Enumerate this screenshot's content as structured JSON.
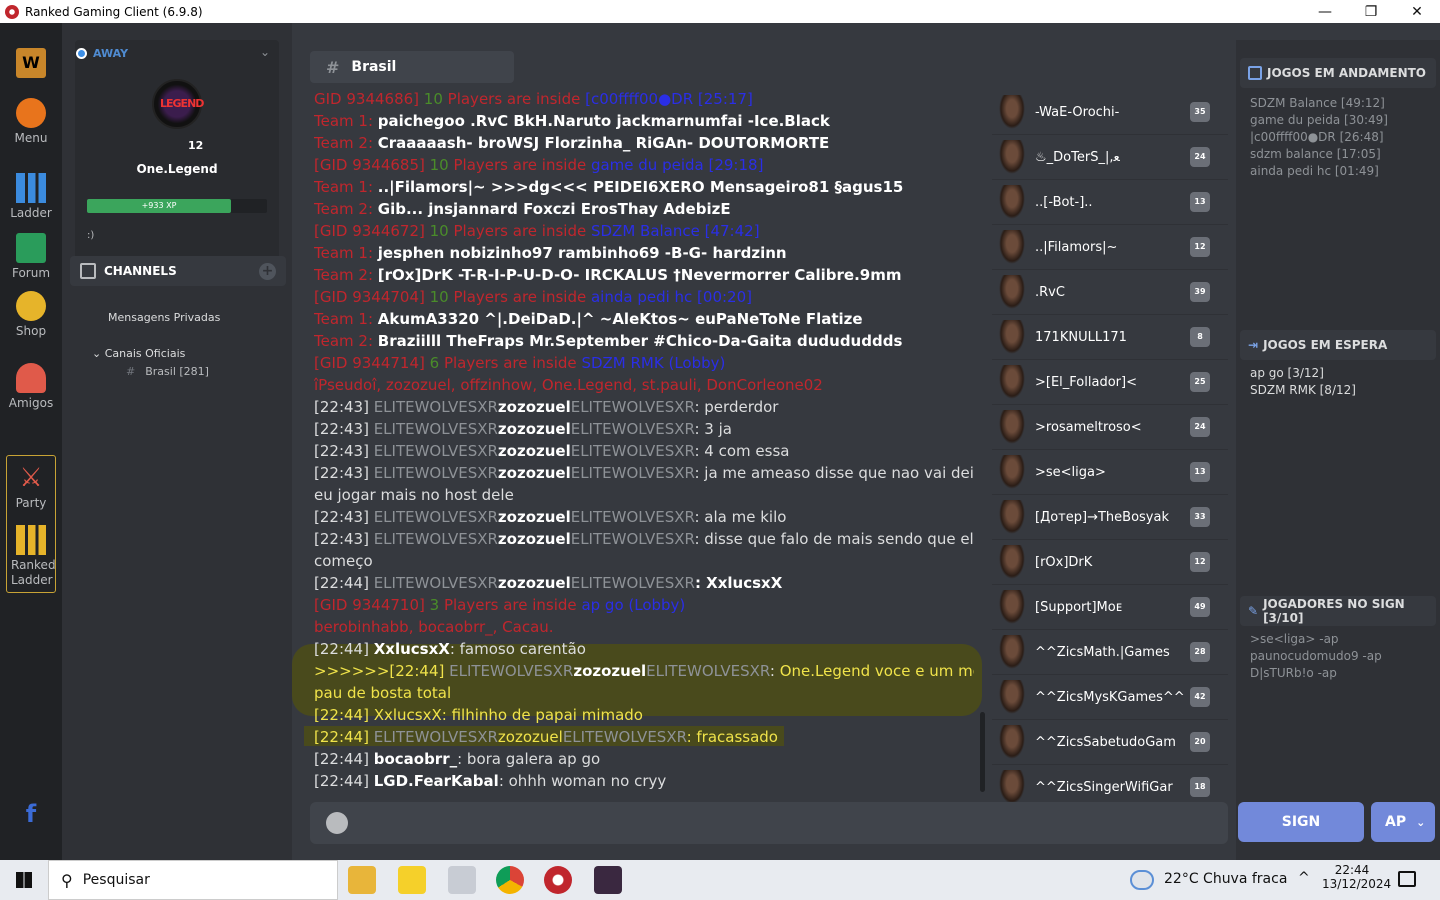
{
  "window": {
    "title": "Ranked Gaming Client (6.9.8)",
    "minimize": "—",
    "maximize": "❐",
    "close": "✕"
  },
  "nav": [
    {
      "label": "Menu"
    },
    {
      "label": "Ladder"
    },
    {
      "label": "Forum"
    },
    {
      "label": "Shop"
    },
    {
      "label": "Amigos"
    },
    {
      "label": "Party"
    },
    {
      "label": "Ranked Ladder"
    }
  ],
  "profile": {
    "status": "AWAY",
    "level": "12",
    "name": "One.Legend",
    "xp": "+933 XP",
    "status_message": ":)",
    "avatar_text": "LEGEND"
  },
  "sidebar": {
    "channels_label": "CHANNELS",
    "private": "Mensagens Privadas",
    "official": "Canais Oficiais",
    "channel": "Brasil [281]"
  },
  "channel": {
    "name": "Brasil"
  },
  "chat": [
    [
      [
        "red",
        "GID 9344686]"
      ],
      [
        "grn",
        " 10 "
      ],
      [
        "red",
        "Players are inside "
      ],
      [
        "blue",
        "[c00ffff00●DR [25:17]"
      ]
    ],
    [
      [
        "red",
        "Team 1:  "
      ],
      [
        "white",
        "paichegoo   .RvC   BkH.Naruto   jackmarnumfai   -Ice.Black"
      ]
    ],
    [
      [
        "red",
        "Team 2:  "
      ],
      [
        "white",
        "Craaaaash-   broWSJ   Florzinha_   RiGAn-   DOUTORMORTE"
      ]
    ],
    [
      [
        "red",
        "[GID 9344685]"
      ],
      [
        "grn",
        " 10 "
      ],
      [
        "red",
        "Players are inside "
      ],
      [
        "blue",
        "game du peida [29:18]"
      ]
    ],
    [
      [
        "red",
        "Team 1:  "
      ],
      [
        "white",
        "..|Filamors|~   >>>dg<<<   PEIDEI6XERO   Mensageiro81   §agus15"
      ]
    ],
    [
      [
        "red",
        "Team 2:  "
      ],
      [
        "white",
        "Gib...   jnsjannard   Foxczi   ErosThay   AdebizE"
      ]
    ],
    [
      [
        "red",
        "[GID 9344672]"
      ],
      [
        "grn",
        " 10 "
      ],
      [
        "red",
        "Players are inside "
      ],
      [
        "blue",
        "SDZM Balance [47:42]"
      ]
    ],
    [
      [
        "red",
        "Team 1:  "
      ],
      [
        "white",
        "jesphen   nobizinho97   rambinho69   -B-G-   hardzinn"
      ]
    ],
    [
      [
        "red",
        "Team 2:  "
      ],
      [
        "white",
        "[rOx]DrK   -T-R-I-P-U-D-O-   IRCKALUS   †Nevermorrer   Calibre.9mm"
      ]
    ],
    [
      [
        "red",
        "[GID 9344704]"
      ],
      [
        "grn",
        " 10 "
      ],
      [
        "red",
        "Players are inside "
      ],
      [
        "blue",
        "ainda pedi hc [00:20]"
      ]
    ],
    [
      [
        "red",
        "Team 1:  "
      ],
      [
        "white",
        "AkumA3320   ^|.DeiDaD.|^   ~AleKtos~   euPaNeToNe   Flatize"
      ]
    ],
    [
      [
        "red",
        "Team 2:  "
      ],
      [
        "white",
        "Braziilll   TheFraps   Mr.September   #Chico-Da-Gaita   dudududdds"
      ]
    ],
    [
      [
        "red",
        "[GID 9344714]"
      ],
      [
        "grn",
        " 6 "
      ],
      [
        "red",
        "Players are inside "
      ],
      [
        "blue",
        "SDZM RMK (Lobby)"
      ]
    ],
    [
      [
        "red",
        "îPseudoî, zozozuel, offzinhow, One.Legend, st.pauli, DonCorleone02"
      ]
    ],
    [
      [
        "",
        "[22:43] "
      ],
      [
        "gray",
        "ELITEWOLVESXR"
      ],
      [
        "white",
        "zozozuel"
      ],
      [
        "gray",
        "ELITEWOLVESXR"
      ],
      [
        "",
        ": perderdor"
      ]
    ],
    [
      [
        "",
        "[22:43] "
      ],
      [
        "gray",
        "ELITEWOLVESXR"
      ],
      [
        "white",
        "zozozuel"
      ],
      [
        "gray",
        "ELITEWOLVESXR"
      ],
      [
        "",
        ": 3 ja"
      ]
    ],
    [
      [
        "",
        "[22:43] "
      ],
      [
        "gray",
        "ELITEWOLVESXR"
      ],
      [
        "white",
        "zozozuel"
      ],
      [
        "gray",
        "ELITEWOLVESXR"
      ],
      [
        "",
        ": 4 com essa"
      ]
    ],
    [
      [
        "",
        "[22:43] "
      ],
      [
        "gray",
        "ELITEWOLVESXR"
      ],
      [
        "white",
        "zozozuel"
      ],
      [
        "gray",
        "ELITEWOLVESXR"
      ],
      [
        "",
        ": ja me ameaso disse que nao vai deixa"
      ]
    ],
    [
      [
        "",
        "eu jogar mais no host dele"
      ]
    ],
    [
      [
        "",
        "[22:43] "
      ],
      [
        "gray",
        "ELITEWOLVESXR"
      ],
      [
        "white",
        "zozozuel"
      ],
      [
        "gray",
        "ELITEWOLVESXR"
      ],
      [
        "",
        ": ala me kilo"
      ]
    ],
    [
      [
        "",
        "[22:43] "
      ],
      [
        "gray",
        "ELITEWOLVESXR"
      ],
      [
        "white",
        "zozozuel"
      ],
      [
        "gray",
        "ELITEWOLVESXR"
      ],
      [
        "",
        ": disse que falo de mais sendo que ele"
      ]
    ],
    [
      [
        "",
        "começo"
      ]
    ],
    [
      [
        "",
        "[22:44] "
      ],
      [
        "gray",
        "ELITEWOLVESXR"
      ],
      [
        "white",
        "zozozuel"
      ],
      [
        "gray",
        "ELITEWOLVESXR"
      ],
      [
        "white",
        ": XxlucsxX"
      ]
    ],
    [
      [
        "red",
        "[GID 9344710]"
      ],
      [
        "grn",
        " 3 "
      ],
      [
        "red",
        "Players are inside "
      ],
      [
        "blue",
        "ap go (Lobby)"
      ]
    ],
    [
      [
        "red",
        "berobinhabb, bocaobrr_, Cacau."
      ]
    ],
    [
      [
        "",
        "[22:44] "
      ],
      [
        "white",
        "XxlucsxX"
      ],
      [
        "",
        ": famoso carentão"
      ]
    ],
    [
      [
        "yel",
        ">>>>>>[22:44] "
      ],
      [
        "gray",
        "ELITEWOLVESXR"
      ],
      [
        "white",
        "zozozuel"
      ],
      [
        "gray",
        "ELITEWOLVESXR"
      ],
      [
        "",
        ": "
      ],
      [
        "yel",
        "One.Legend"
      ],
      [
        "yel",
        " voce e um merda"
      ]
    ],
    [
      [
        "yel",
        "pau de bosta total"
      ]
    ],
    [
      [
        "yel",
        "[22:44] "
      ],
      [
        "yel",
        "XxlucsxX"
      ],
      [
        "yel",
        ": filhinho de papai mimado"
      ]
    ],
    [
      [
        "yel",
        "[22:44] "
      ],
      [
        "gray",
        "ELITEWOLVESXR"
      ],
      [
        "yel",
        "zozozuel"
      ],
      [
        "gray",
        "ELITEWOLVESXR"
      ],
      [
        "yel",
        ": fracassado"
      ]
    ],
    [
      [
        "",
        "[22:44] "
      ],
      [
        "white",
        "bocaobrr_"
      ],
      [
        "",
        ": bora galera ap go"
      ]
    ],
    [
      [
        "",
        "[22:44] "
      ],
      [
        "white",
        "LGD.FearKabal"
      ],
      [
        "",
        ": ohhh woman no cryy"
      ]
    ]
  ],
  "users": [
    {
      "name": "-WaE-Orochi-",
      "lvl": "35"
    },
    {
      "name": "♨_DoTerS_|,ﻌ",
      "lvl": "24"
    },
    {
      "name": "..[-Bot-]..",
      "lvl": "13"
    },
    {
      "name": "..|Filamors|~",
      "lvl": "12"
    },
    {
      "name": ".RvC",
      "lvl": "39"
    },
    {
      "name": "171KNULL171",
      "lvl": "8"
    },
    {
      "name": ">[El_Follador]<",
      "lvl": "25"
    },
    {
      "name": ">rosameltroso<",
      "lvl": "24"
    },
    {
      "name": ">se<liga>",
      "lvl": "13"
    },
    {
      "name": "[Дотер]→TheBosyak",
      "lvl": "33"
    },
    {
      "name": "[rOx]DrK",
      "lvl": "12"
    },
    {
      "name": "[Support]Mᴏᴇ",
      "lvl": "49"
    },
    {
      "name": "^^ZicsMath.|Games",
      "lvl": "28"
    },
    {
      "name": "^^ZicsMysKGames^^",
      "lvl": "42"
    },
    {
      "name": "^^ZicsSabetudoGam",
      "lvl": "20"
    },
    {
      "name": "^^ZicsSingerWifiGar",
      "lvl": "18"
    }
  ],
  "right": {
    "games_running": "JOGOS EM ANDAMENTO",
    "running": [
      "SDZM Balance [49:12]",
      "game du peida [30:49]",
      "|c00ffff00●DR [26:48]",
      "sdzm balance [17:05]",
      "ainda pedi hc [01:49]"
    ],
    "games_waiting": "JOGOS EM ESPERA",
    "waiting": [
      "ap go [3/12]",
      "SDZM RMK [8/12]"
    ],
    "sign_players": "JOGADORES NO SIGN [3/10]",
    "signers": [
      ">se<liga> -ap",
      "paunocudomudo9 -ap",
      "D|sTURb!o -ap"
    ]
  },
  "buttons": {
    "sign": "SIGN",
    "ap": "AP"
  },
  "taskbar": {
    "search": "Pesquisar",
    "weather": "22°C  Chuva fraca",
    "time": "22:44",
    "date": "13/12/2024"
  }
}
